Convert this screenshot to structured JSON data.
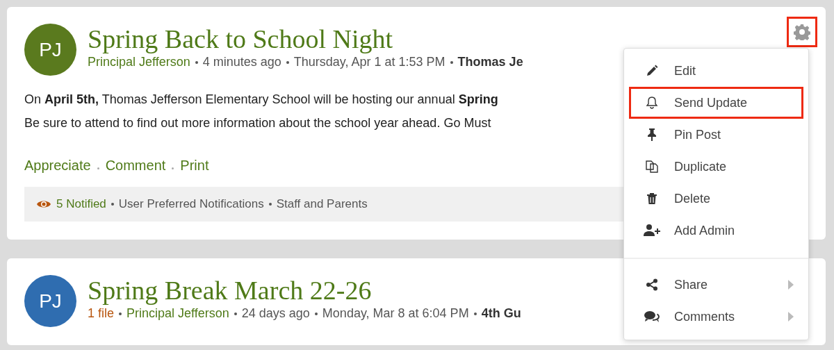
{
  "posts": [
    {
      "avatar": {
        "initials": "PJ",
        "color": "#5a7a1e"
      },
      "title": "Spring Back to School Night",
      "settings": {
        "highlighted": true
      },
      "meta": [
        {
          "kind": "author",
          "text": "Principal Jefferson"
        },
        {
          "kind": "plain",
          "text": "4 minutes ago"
        },
        {
          "kind": "plain",
          "text": "Thursday, Apr 1 at 1:53 PM"
        },
        {
          "kind": "strong",
          "text": "Thomas Je"
        }
      ],
      "body_lines": [
        "On **April 5th,** Thomas Jefferson Elementary School will be hosting our annual **Spring**",
        "Be sure to attend to find out more information about the school year ahead. Go Must"
      ],
      "actions": [
        "Appreciate",
        "Comment",
        "Print"
      ],
      "notice": {
        "count": "5 Notified",
        "details": [
          "User Preferred Notifications",
          "Staff and Parents"
        ]
      }
    },
    {
      "avatar": {
        "initials": "PJ",
        "color": "#2f6db0"
      },
      "title": "Spring Break March 22-26",
      "meta": [
        {
          "kind": "file",
          "text": "1 file"
        },
        {
          "kind": "author",
          "text": "Principal Jefferson"
        },
        {
          "kind": "plain",
          "text": "24 days ago"
        },
        {
          "kind": "plain",
          "text": "Monday, Mar 8 at 6:04 PM"
        },
        {
          "kind": "strong",
          "text": "4th Gu"
        }
      ]
    }
  ],
  "menu": {
    "groups": [
      [
        {
          "label": "Edit",
          "highlighted": false
        },
        {
          "label": "Send Update",
          "highlighted": true
        },
        {
          "label": "Pin Post",
          "highlighted": false
        },
        {
          "label": "Duplicate",
          "highlighted": false
        },
        {
          "label": "Delete",
          "highlighted": false
        },
        {
          "label": "Add Admin",
          "highlighted": false
        }
      ],
      [
        {
          "label": "Share",
          "highlighted": false,
          "submenu": true
        },
        {
          "label": "Comments",
          "highlighted": false,
          "submenu": true
        }
      ]
    ]
  }
}
